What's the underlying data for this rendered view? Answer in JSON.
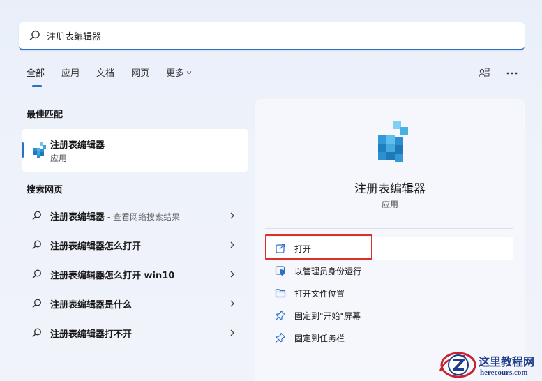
{
  "search": {
    "query": "注册表编辑器",
    "icon": "search-icon"
  },
  "tabs": [
    {
      "label": "全部",
      "active": true
    },
    {
      "label": "应用",
      "active": false
    },
    {
      "label": "文档",
      "active": false
    },
    {
      "label": "网页",
      "active": false
    },
    {
      "label": "更多",
      "active": false
    }
  ],
  "toolbar": {
    "icons": [
      "account-switch-icon",
      "more-options-icon"
    ]
  },
  "best_match": {
    "heading": "最佳匹配",
    "name": "注册表编辑器",
    "type": "应用",
    "icon": "regedit-icon"
  },
  "web_search": {
    "heading": "搜索网页",
    "items": [
      {
        "text": "注册表编辑器",
        "sub": " - 查看网络搜索结果"
      },
      {
        "text": "注册表编辑器怎么打开",
        "sub": ""
      },
      {
        "text": "注册表编辑器怎么打开 win10",
        "sub": ""
      },
      {
        "text": "注册表编辑器是什么",
        "sub": ""
      },
      {
        "text": "注册表编辑器打不开",
        "sub": ""
      }
    ]
  },
  "detail": {
    "name": "注册表编辑器",
    "type": "应用",
    "actions": [
      {
        "label": "打开",
        "icon": "open-external-icon"
      },
      {
        "label": "以管理员身份运行",
        "icon": "admin-shield-icon"
      },
      {
        "label": "打开文件位置",
        "icon": "folder-icon"
      },
      {
        "label": "固定到\"开始\"屏幕",
        "icon": "pin-icon"
      },
      {
        "label": "固定到任务栏",
        "icon": "pin-icon"
      }
    ]
  },
  "colors": {
    "accent": "#2a6fc9",
    "highlight": "#d9302c",
    "watermark": "#1f3d8c"
  },
  "watermark": {
    "title": "这里教程网",
    "url": "herecours.com"
  }
}
